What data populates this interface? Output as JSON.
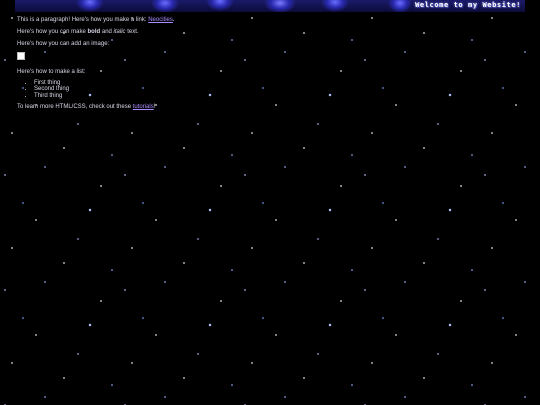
{
  "header": {
    "title": "Welcome to my Website!"
  },
  "content": {
    "p1_text": "This is a paragraph! Here's how you make a link: ",
    "p1_link": "Neocities",
    "p1_end": ".",
    "p2_start": "Here's how you can make ",
    "p2_bold": "bold",
    "p2_mid": " and ",
    "p2_italic": "italic",
    "p2_end": " text.",
    "p3_text": "Here's how you can add an image:",
    "p4_text": "Here's how to make a list:",
    "list_items": [
      "First thing",
      "Second thing",
      "Third thing"
    ],
    "p5_text": "To learn more HTML/CSS, check out these ",
    "p5_link": "tutorials",
    "p5_end": "!"
  }
}
